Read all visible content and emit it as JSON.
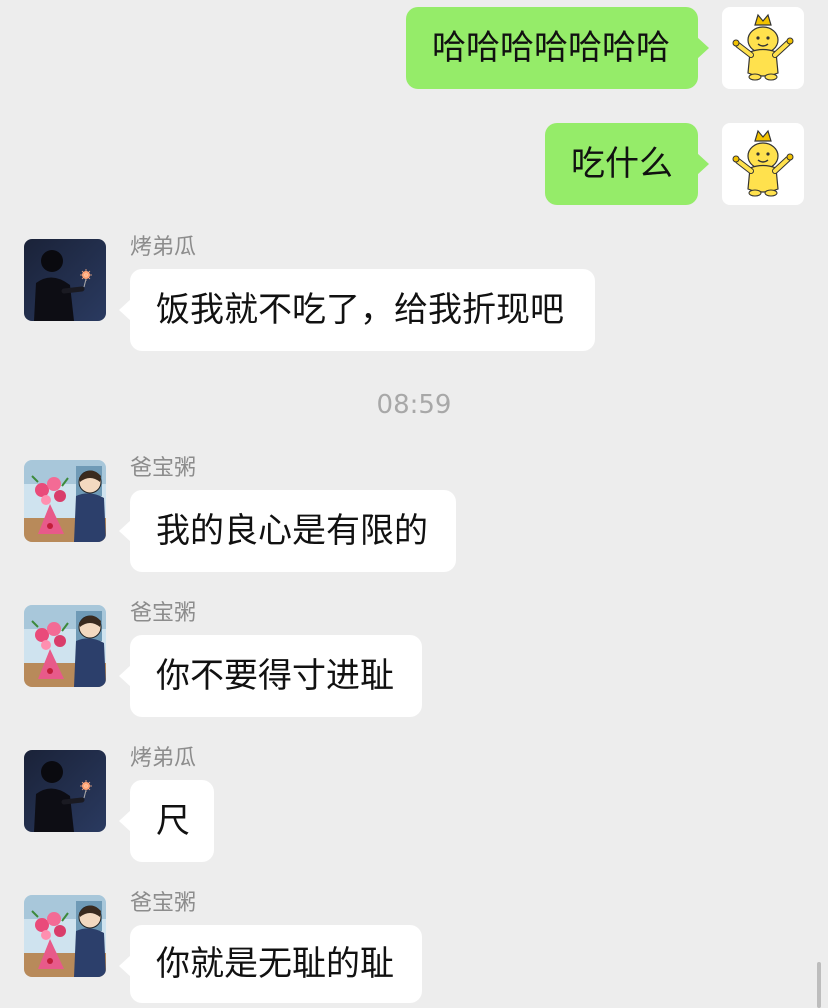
{
  "messages": [
    {
      "direction": "out",
      "text": "哈哈哈哈哈哈哈"
    },
    {
      "direction": "out",
      "text": "吃什么"
    },
    {
      "direction": "in",
      "sender": "烤弟瓜",
      "text": "饭我就不吃了，给我折现吧"
    },
    {
      "direction": "in",
      "sender": "爸宝粥",
      "text": "我的良心是有限的"
    },
    {
      "direction": "in",
      "sender": "爸宝粥",
      "text": "你不要得寸进耻"
    },
    {
      "direction": "in",
      "sender": "烤弟瓜",
      "text": "尺"
    },
    {
      "direction": "in",
      "sender": "爸宝粥",
      "text": "你就是无耻的耻"
    }
  ],
  "timestamp": "08:59",
  "colors": {
    "background": "#ededed",
    "outgoing_bubble": "#95ec69",
    "incoming_bubble": "#ffffff"
  },
  "avatars": {
    "self": "yellow-crown-character-avatar",
    "烤弟瓜": "dark-person-sparkler-avatar",
    "爸宝粥": "cartoon-flowers-avatar"
  }
}
